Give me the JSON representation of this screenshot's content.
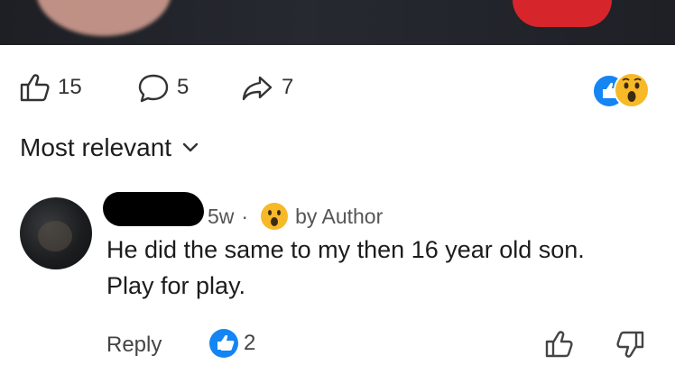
{
  "post": {
    "actions": {
      "like_count": "15",
      "comment_count": "5",
      "share_count": "7"
    },
    "reaction_icons": [
      "like-reaction",
      "wow-reaction"
    ]
  },
  "comments_sort": {
    "label": "Most relevant"
  },
  "comment": {
    "time": "5w",
    "separator": "·",
    "reaction_by_author": "by Author",
    "text_line1": "He did the same to my then 16 year old son.",
    "text_line2": "Play for play.",
    "reply_label": "Reply",
    "like_count": "2"
  },
  "colors": {
    "like_blue": "#1485f2",
    "wow_yellow": "#f7b928",
    "text": "#1c1c1e",
    "muted": "#555555"
  }
}
